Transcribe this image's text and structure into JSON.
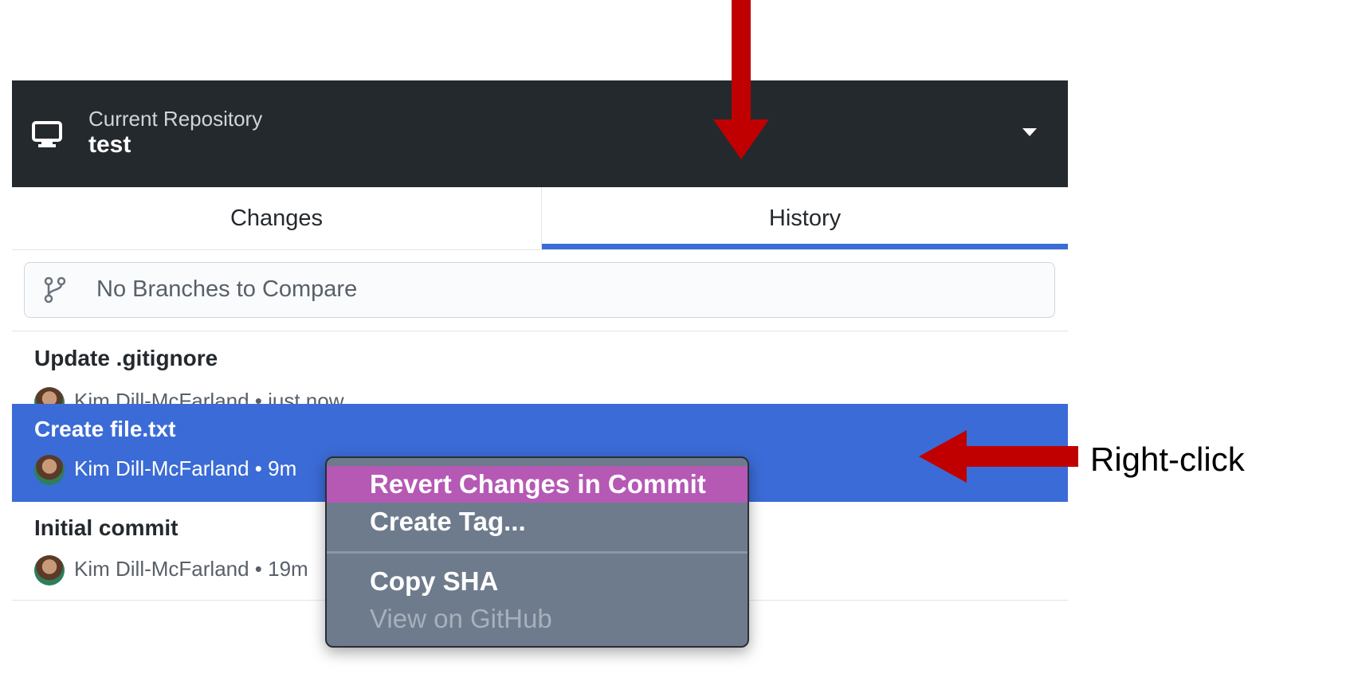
{
  "repository": {
    "caption": "Current Repository",
    "name": "test",
    "icon": "computer-icon"
  },
  "tabs": [
    {
      "label": "Changes",
      "selected": false
    },
    {
      "label": "History",
      "selected": true
    }
  ],
  "compare": {
    "label": "No Branches to Compare",
    "icon": "git-branch-icon"
  },
  "commits": [
    {
      "title": "Update .gitignore",
      "author_line": "Kim Dill-McFarland • just now",
      "selected": false
    },
    {
      "title": "Create file.txt",
      "author_line": "Kim Dill-McFarland • 9m",
      "selected": true
    },
    {
      "title": "Initial commit",
      "author_line": "Kim Dill-McFarland • 19m",
      "selected": false
    }
  ],
  "context_menu": {
    "items": [
      {
        "label": "Revert Changes in Commit",
        "highlighted": true,
        "enabled": true
      },
      {
        "label": "Create Tag...",
        "highlighted": false,
        "enabled": true
      },
      {
        "label": "Copy SHA",
        "highlighted": false,
        "enabled": true
      },
      {
        "label": "View on GitHub",
        "highlighted": false,
        "enabled": false
      }
    ]
  },
  "annotation": {
    "label": "Right-click",
    "arrow_color": "#c00000"
  },
  "colors": {
    "repo_bar": "#24292e",
    "selection": "#3b6bd6",
    "menu_highlight": "#b559b5"
  }
}
